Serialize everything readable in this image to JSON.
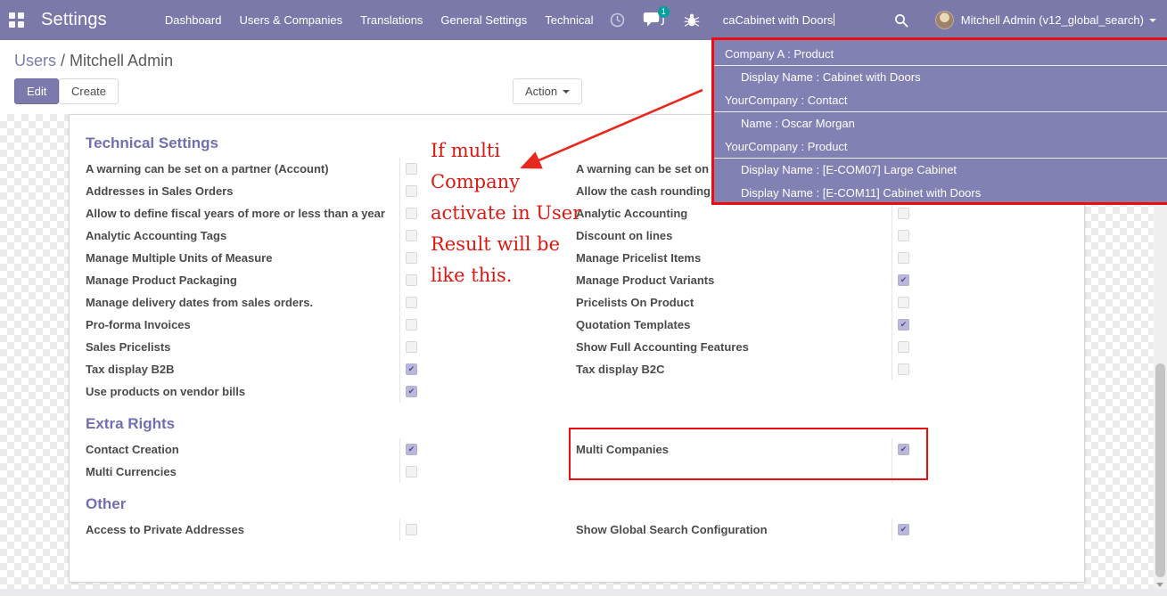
{
  "colors": {
    "accent": "#7c7bad",
    "navbar": "#7b79aa",
    "dropdown": "#8281b4",
    "badge_teal": "#00a09d",
    "annotation_red": "#f00c0c",
    "checked_purple": "#b9b7da"
  },
  "navbar": {
    "title": "Settings",
    "menu_items": [
      "Dashboard",
      "Users & Companies",
      "Translations",
      "General Settings",
      "Technical"
    ],
    "message_badge": "1",
    "search_value": "caCabinet with Doors",
    "user_name": "Mitchell Admin (v12_global_search)"
  },
  "search_dropdown": {
    "groups": [
      {
        "header": "Company A : Product",
        "items": [
          "Display Name : Cabinet with Doors"
        ]
      },
      {
        "header": "YourCompany : Contact",
        "items": [
          "Name : Oscar Morgan"
        ]
      },
      {
        "header": "YourCompany : Product",
        "items": [
          "Display Name : [E-COM07] Large Cabinet",
          "Display Name : [E-COM11] Cabinet with Doors"
        ]
      }
    ]
  },
  "control_panel": {
    "breadcrumb": {
      "parent": "Users",
      "separator": " / ",
      "current": "Mitchell Admin"
    },
    "edit_label": "Edit",
    "create_label": "Create",
    "action_label": "Action"
  },
  "form": {
    "sections": [
      {
        "title": "Technical Settings",
        "left": [
          {
            "label": "A warning can be set on a partner (Account)",
            "checked": false
          },
          {
            "label": "Addresses in Sales Orders",
            "checked": false
          },
          {
            "label": "Allow to define fiscal years of more or less than a year",
            "checked": false
          },
          {
            "label": "Analytic Accounting Tags",
            "checked": false
          },
          {
            "label": "Manage Multiple Units of Measure",
            "checked": false
          },
          {
            "label": "Manage Product Packaging",
            "checked": false
          },
          {
            "label": "Manage delivery dates from sales orders.",
            "checked": false
          },
          {
            "label": "Pro-forma Invoices",
            "checked": false
          },
          {
            "label": "Sales Pricelists",
            "checked": false
          },
          {
            "label": "Tax display B2B",
            "checked": true
          },
          {
            "label": "Use products on vendor bills",
            "checked": true
          }
        ],
        "right": [
          {
            "label": "A warning can be set on a",
            "checked": false
          },
          {
            "label": "Allow the cash rounding r",
            "checked": false
          },
          {
            "label": "Analytic Accounting",
            "checked": false
          },
          {
            "label": "Discount on lines",
            "checked": false
          },
          {
            "label": "Manage Pricelist Items",
            "checked": false
          },
          {
            "label": "Manage Product Variants",
            "checked": true
          },
          {
            "label": "Pricelists On Product",
            "checked": false
          },
          {
            "label": "Quotation Templates",
            "checked": true
          },
          {
            "label": "Show Full Accounting Features",
            "checked": false
          },
          {
            "label": "Tax display B2C",
            "checked": false
          }
        ]
      },
      {
        "title": "Extra Rights",
        "left": [
          {
            "label": "Contact Creation",
            "checked": true
          },
          {
            "label": "Multi Currencies",
            "checked": false
          }
        ],
        "right": [
          {
            "label": "Multi Companies",
            "checked": true
          },
          {
            "label": null,
            "checked": null
          }
        ]
      },
      {
        "title": "Other",
        "left": [
          {
            "label": "Access to Private Addresses",
            "checked": false
          }
        ],
        "right": [
          {
            "label": "Show Global Search Configuration",
            "checked": true
          }
        ]
      }
    ]
  },
  "annotation": {
    "lines": [
      "If multi",
      "Company",
      "activate in User",
      "Result will be",
      "like this."
    ]
  }
}
